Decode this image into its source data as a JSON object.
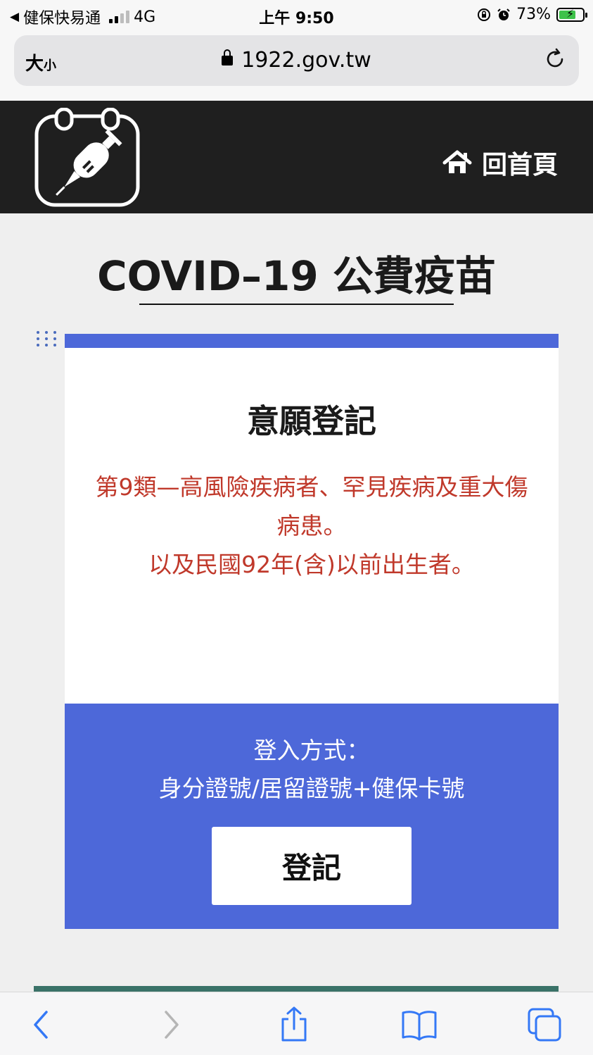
{
  "status_bar": {
    "back_app": "健保快易通",
    "network": "4G",
    "time": "上午 9:50",
    "battery": "73%",
    "battery_level": 0.73,
    "battery_color": "#3ec24a"
  },
  "browser": {
    "text_size_label": "大",
    "text_size_small": "小",
    "url": "1922.gov.tw"
  },
  "header": {
    "logo": "vaccine-calendar-icon",
    "home_label": "回首頁",
    "home_icon": "home-icon"
  },
  "page": {
    "title": "COVID–19 公費疫苗"
  },
  "card": {
    "title": "意願登記",
    "desc_line1": "第9類—高風險疾病者、罕見疾病及重大傷",
    "desc_line2": "病患。",
    "desc_line3": "以及民國92年(含)以前出生者。",
    "login_title": "登入方式：",
    "login_methods": "身分證號/居留證號+健保卡號",
    "register_label": "登記",
    "accent_color": "#4d68d9",
    "desc_color": "#c0392b"
  },
  "toolbar": {
    "items": [
      "back-icon",
      "forward-icon",
      "share-icon",
      "bookmarks-icon",
      "tabs-icon"
    ]
  }
}
